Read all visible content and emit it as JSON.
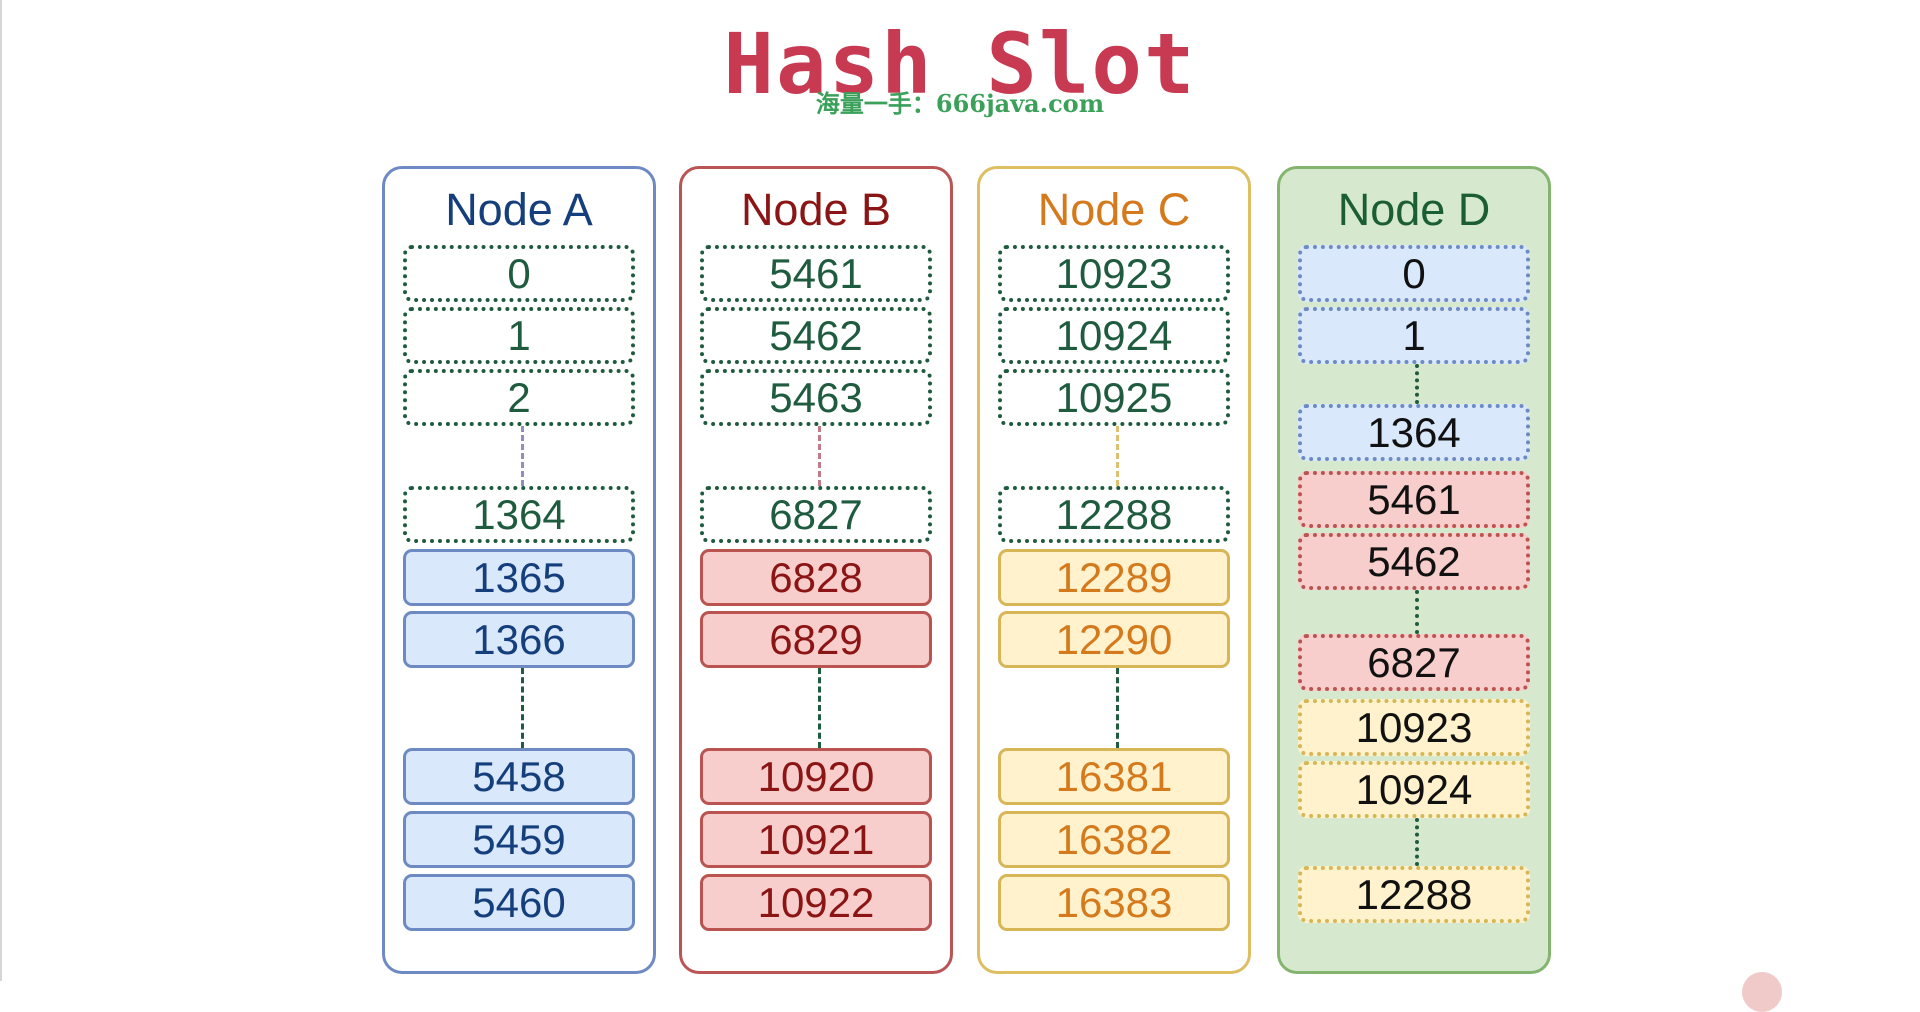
{
  "title": "Hash Slot",
  "watermark": "海量一手：666java.com",
  "nodes": [
    {
      "id": "a",
      "name": "Node A",
      "slots": [
        "0",
        "1",
        "2",
        "1364",
        "1365",
        "1366",
        "5458",
        "5459",
        "5460"
      ]
    },
    {
      "id": "b",
      "name": "Node B",
      "slots": [
        "5461",
        "5462",
        "5463",
        "6827",
        "6828",
        "6829",
        "10920",
        "10921",
        "10922"
      ]
    },
    {
      "id": "c",
      "name": "Node C",
      "slots": [
        "10923",
        "10924",
        "10925",
        "12288",
        "12289",
        "12290",
        "16381",
        "16382",
        "16383"
      ]
    },
    {
      "id": "d",
      "name": "Node D",
      "slots": [
        "0",
        "1",
        "1364",
        "5461",
        "5462",
        "6827",
        "10923",
        "10924",
        "12288"
      ]
    }
  ],
  "colors": {
    "title": "#c73a52",
    "node_a": "#153f7c",
    "node_b": "#8b1414",
    "node_c": "#d57a1c",
    "node_d": "#1b5e33",
    "migrating_slot_border": "#1f5b3e"
  }
}
